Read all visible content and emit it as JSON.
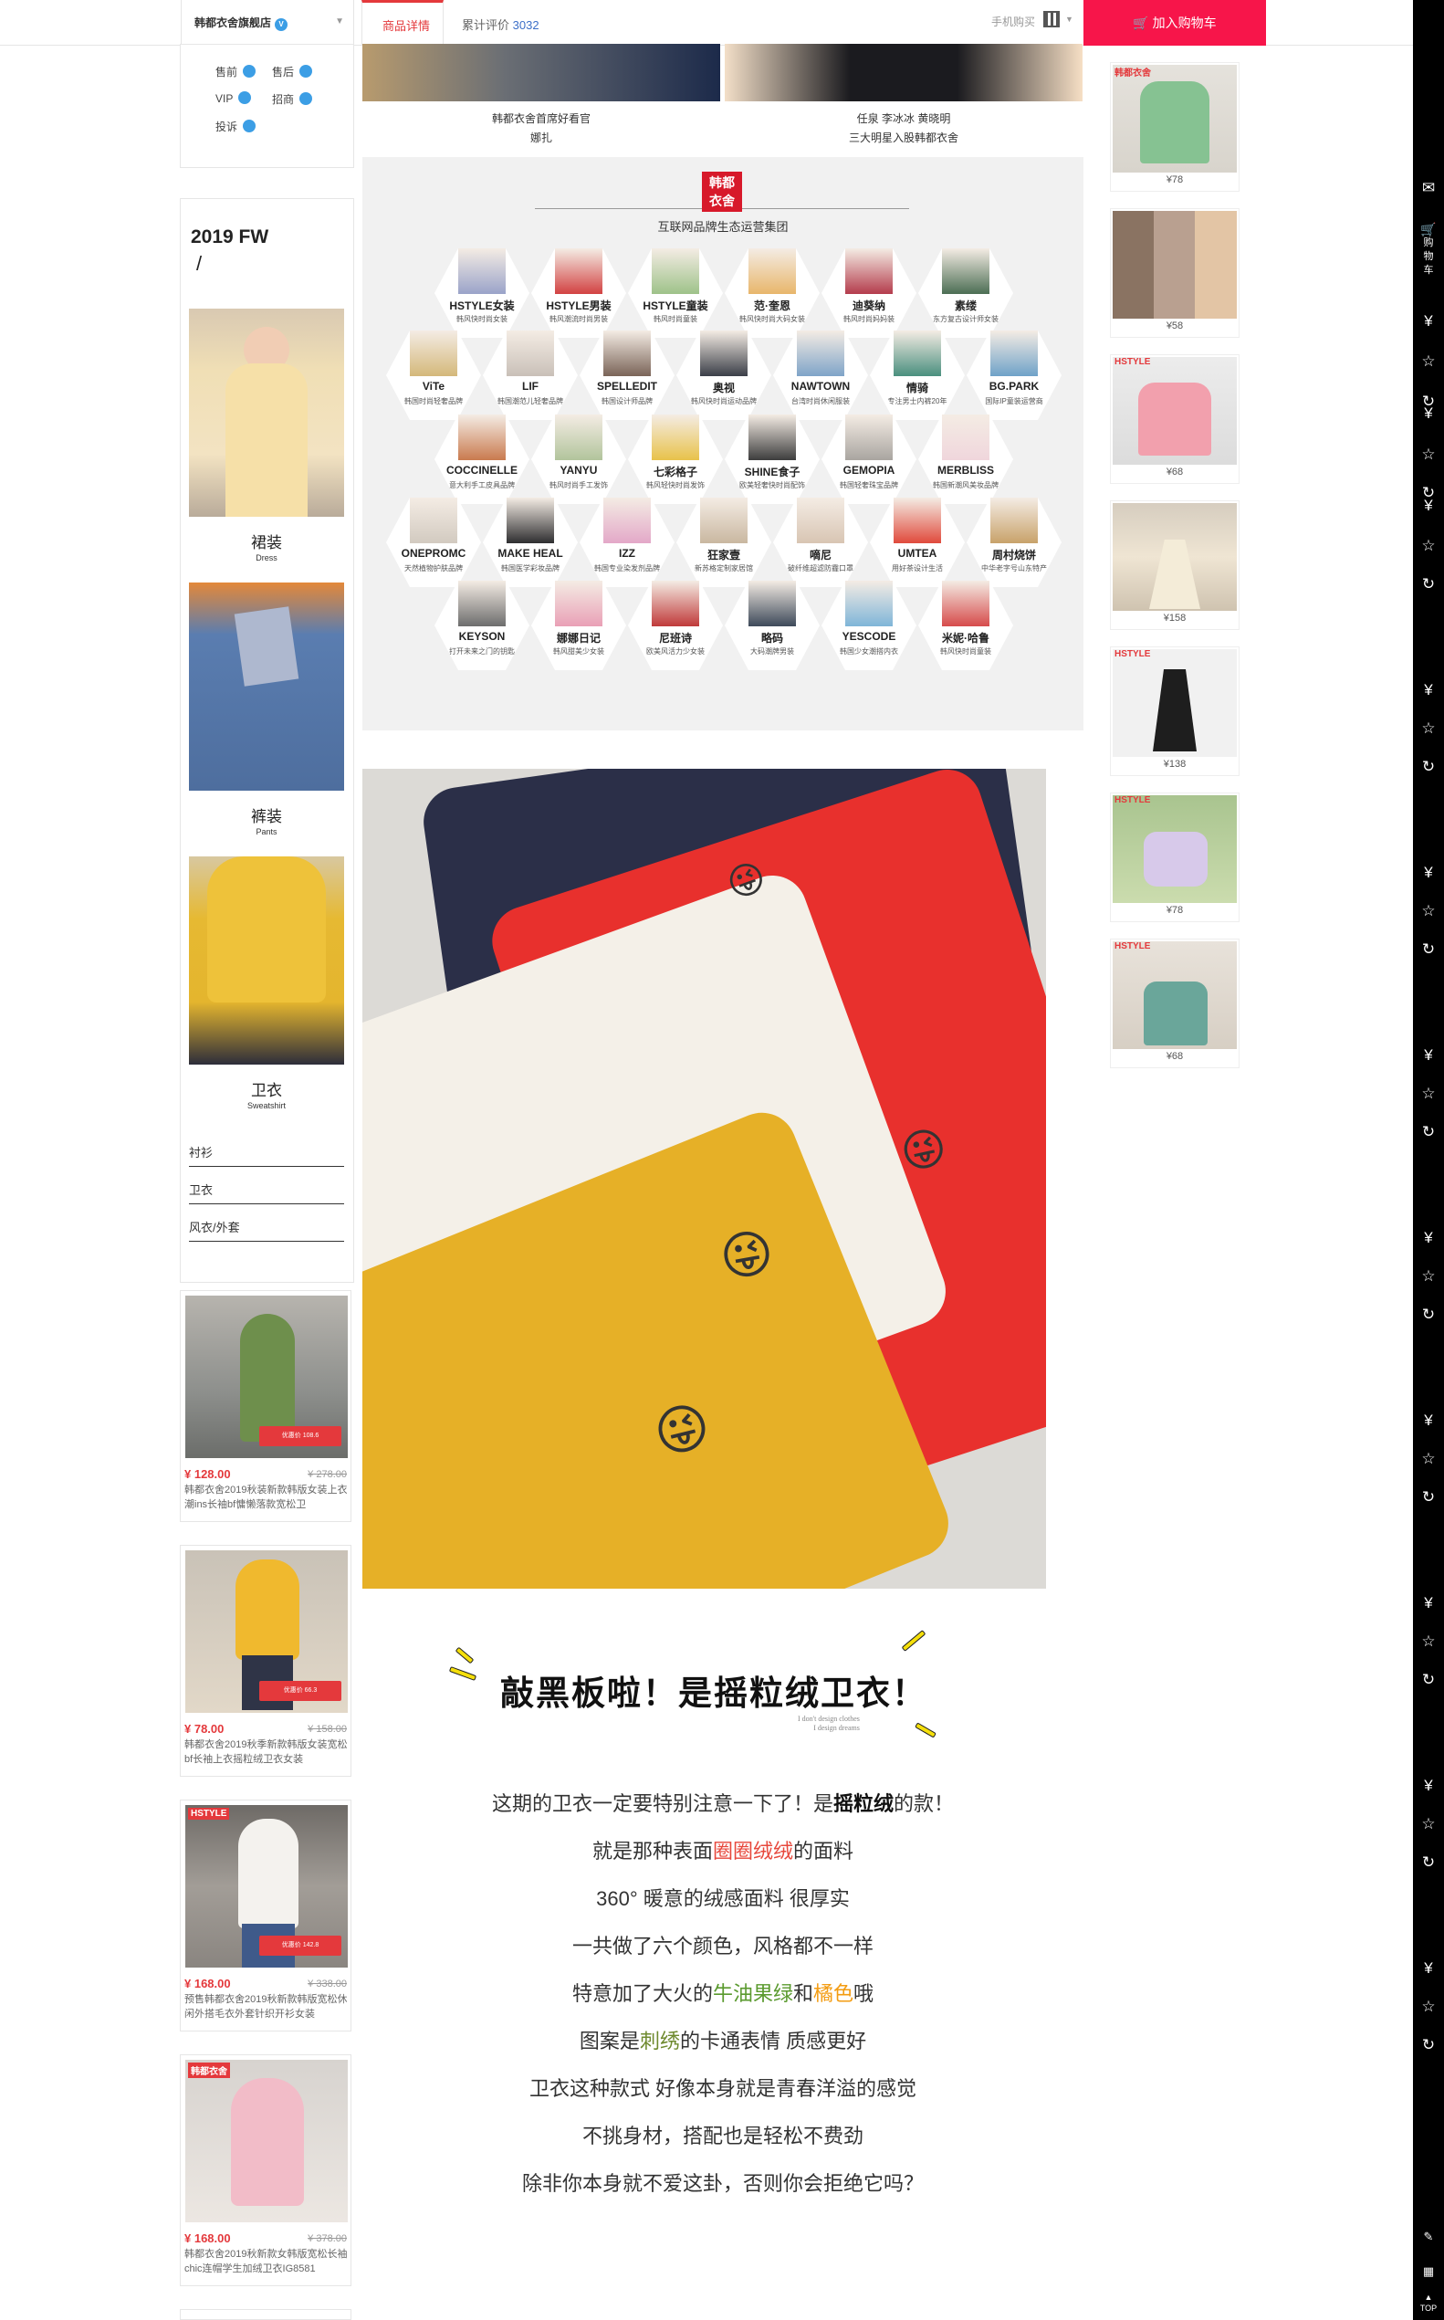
{
  "topbar": {
    "shop_name": "韩都衣舍旗舰店",
    "tab_detail": "商品详情",
    "tab_review_label": "累计评价",
    "tab_review_count": "3032",
    "mobile_buy": "手机购买",
    "add_to_cart": "加入购物车"
  },
  "service": {
    "pre_sale": "售前",
    "after_sale": "售后",
    "vip": "VIP",
    "recruit": "招商",
    "complaint": "投诉"
  },
  "category": {
    "season": "2019 FW",
    "slash": "/",
    "items": [
      {
        "zh": "裙装",
        "en": "Dress"
      },
      {
        "zh": "裤装",
        "en": "Pants"
      },
      {
        "zh": "卫衣",
        "en": "Sweatshirt"
      }
    ],
    "links": [
      "衬衫",
      "卫衣",
      "风衣/外套"
    ]
  },
  "left_products": [
    {
      "price": "¥ 128.00",
      "original": "¥ 278.00",
      "title": "韩都衣舍2019秋装新款韩版女装上衣潮ins长袖bf慵懒落款宽松卫",
      "tag": "优惠价 108.6"
    },
    {
      "price": "¥ 78.00",
      "original": "¥ 158.00",
      "title": "韩都衣舍2019秋季新款韩版女装宽松bf长袖上衣摇粒绒卫衣女装",
      "tag": "优惠价 66.3"
    },
    {
      "price": "¥ 168.00",
      "original": "¥ 338.00",
      "title": "预售韩都衣舍2019秋新款韩版宽松休闲外搭毛衣外套针织开衫女装",
      "tag": "优惠价 142.8",
      "brand": "HSTYLE"
    },
    {
      "price": "¥ 168.00",
      "original": "¥ 378.00",
      "title": "韩都衣舍2019秋新款女韩版宽松长袖chic连帽学生加绒卫衣IG8581",
      "brand": "韩都衣舍"
    }
  ],
  "right_products": [
    {
      "price": "¥78",
      "brand": "韩都衣舍"
    },
    {
      "price": "¥58"
    },
    {
      "price": "¥68",
      "brand": "HSTYLE"
    },
    {
      "price": "¥158"
    },
    {
      "price": "¥138",
      "brand": "HSTYLE"
    },
    {
      "price": "¥78",
      "brand": "HSTYLE"
    },
    {
      "price": "¥68",
      "brand": "HSTYLE"
    }
  ],
  "right_bar": {
    "cart_label": "购物车",
    "top_label": "TOP"
  },
  "hero": {
    "left_caption_1": "韩都衣舍首席好看官",
    "left_caption_2": "娜扎",
    "right_caption_1": "任泉 李冰冰 黄晓明",
    "right_caption_2": "三大明星入股韩都衣舍"
  },
  "group": {
    "logo_text_1": "韩都",
    "logo_text_2": "衣舍",
    "subtitle": "互联网品牌生态运营集团",
    "brands": [
      {
        "name": "HSTYLE女装",
        "desc": "韩风快时尚女装",
        "color": "#9aa3c9"
      },
      {
        "name": "HSTYLE男装",
        "desc": "韩风潮流时尚男装",
        "color": "#d24242"
      },
      {
        "name": "HSTYLE童装",
        "desc": "韩风时尚童装",
        "color": "#9ec289"
      },
      {
        "name": "范·奎恩",
        "desc": "韩风快时尚大码女装",
        "color": "#e8b66b"
      },
      {
        "name": "迪葵纳",
        "desc": "韩风时尚妈妈装",
        "color": "#b43c4c"
      },
      {
        "name": "素缕",
        "desc": "东方复古设计师女装",
        "color": "#4c6e54"
      },
      {
        "name": "ViTe",
        "desc": "韩国时尚轻奢品牌",
        "color": "#d4b87a"
      },
      {
        "name": "LIF",
        "desc": "韩国潮范儿轻奢品牌",
        "color": "#c9c0b8"
      },
      {
        "name": "SPELLEDIT",
        "desc": "韩国设计师品牌",
        "color": "#7a6458"
      },
      {
        "name": "奥视",
        "desc": "韩风快时尚运动品牌",
        "color": "#3b3f48"
      },
      {
        "name": "NAWTOWN",
        "desc": "台湾时尚休闲服装",
        "color": "#7fa4c8"
      },
      {
        "name": "情骑",
        "desc": "专注男士内裤20年",
        "color": "#4a8f7e"
      },
      {
        "name": "BG.PARK",
        "desc": "国际IP童装运营商",
        "color": "#6fa2c8"
      },
      {
        "name": "COCCINELLE",
        "desc": "意大利手工皮具品牌",
        "color": "#c97a4e"
      },
      {
        "name": "YANYU",
        "desc": "韩风时尚手工发饰",
        "color": "#b2c49c"
      },
      {
        "name": "七彩格子",
        "desc": "韩风轻快时尚发饰",
        "color": "#e8c24a"
      },
      {
        "name": "SHINE食子",
        "desc": "欧美轻奢快时尚配饰",
        "color": "#3d3d3d"
      },
      {
        "name": "GEMOPIA",
        "desc": "韩国轻奢珠宝品牌",
        "color": "#a9a5a0"
      },
      {
        "name": "MERBLISS",
        "desc": "韩国新潮风美妆品牌",
        "color": "#f0d6dc"
      },
      {
        "name": "ONEPROMC",
        "desc": "天然植物护肤品牌",
        "color": "#d2cac0"
      },
      {
        "name": "MAKE HEAL",
        "desc": "韩国医学彩妆品牌",
        "color": "#2e2e30"
      },
      {
        "name": "IZZ",
        "desc": "韩国专业染发剂品牌",
        "color": "#e3a8c8"
      },
      {
        "name": "狂家壹",
        "desc": "新苏格定制家居馆",
        "color": "#c9b7a0"
      },
      {
        "name": "嘀尼",
        "desc": "破纤维超滤防霾口罩",
        "color": "#d8c5b3"
      },
      {
        "name": "UMTEA",
        "desc": "用好茶设计生活",
        "color": "#e04a3c"
      },
      {
        "name": "周村烧饼",
        "desc": "中华老字号山东特产",
        "color": "#c8a26a"
      },
      {
        "name": "KEYSON",
        "desc": "打开未来之门的钥匙",
        "color": "#6d6d6d"
      },
      {
        "name": "娜娜日记",
        "desc": "韩风甜美少女装",
        "color": "#e9a0b6"
      },
      {
        "name": "尼班诗",
        "desc": "欧美风活力少女装",
        "color": "#c03a3a"
      },
      {
        "name": "略码",
        "desc": "大码潮牌男装",
        "color": "#3e4a5a"
      },
      {
        "name": "YESCODE",
        "desc": "韩国少女潮搭内衣",
        "color": "#7fb5d8"
      },
      {
        "name": "米妮·哈鲁",
        "desc": "韩风快时尚童装",
        "color": "#d64b4b"
      }
    ]
  },
  "headline": {
    "title": "敲黑板啦！是摇粒绒卫衣！",
    "en_line_1": "I don't design clothes",
    "en_line_2": "I design dreams"
  },
  "description": [
    {
      "parts": [
        {
          "t": "这期的卫衣一定要特别注意一下了！是"
        },
        {
          "t": "摇粒绒",
          "c": "em"
        },
        {
          "t": "的款！"
        }
      ]
    },
    {
      "parts": [
        {
          "t": "就是那种表面"
        },
        {
          "t": "圈圈绒绒",
          "c": "red"
        },
        {
          "t": "的面料"
        }
      ]
    },
    {
      "parts": [
        {
          "t": "360° 暖意的绒感面料  很厚实"
        }
      ]
    },
    {
      "parts": [
        {
          "t": "一共做了六个颜色，风格都不一样"
        }
      ]
    },
    {
      "parts": [
        {
          "t": "特意加了大火的"
        },
        {
          "t": "牛油果绿",
          "c": "grn"
        },
        {
          "t": "和"
        },
        {
          "t": "橘色",
          "c": "org"
        },
        {
          "t": "哦"
        }
      ]
    },
    {
      "parts": [
        {
          "t": "图案是"
        },
        {
          "t": "刺绣",
          "c": "olv"
        },
        {
          "t": "的卡通表情    质感更好"
        }
      ]
    },
    {
      "parts": [
        {
          "t": "卫衣这种款式  好像本身就是青春洋溢的感觉"
        }
      ]
    },
    {
      "parts": [
        {
          "t": "不挑身材，搭配也是轻松不费劲"
        }
      ]
    },
    {
      "parts": [
        {
          "t": "除非你本身就不爱这卦，否则你会拒绝它吗？"
        }
      ]
    }
  ]
}
